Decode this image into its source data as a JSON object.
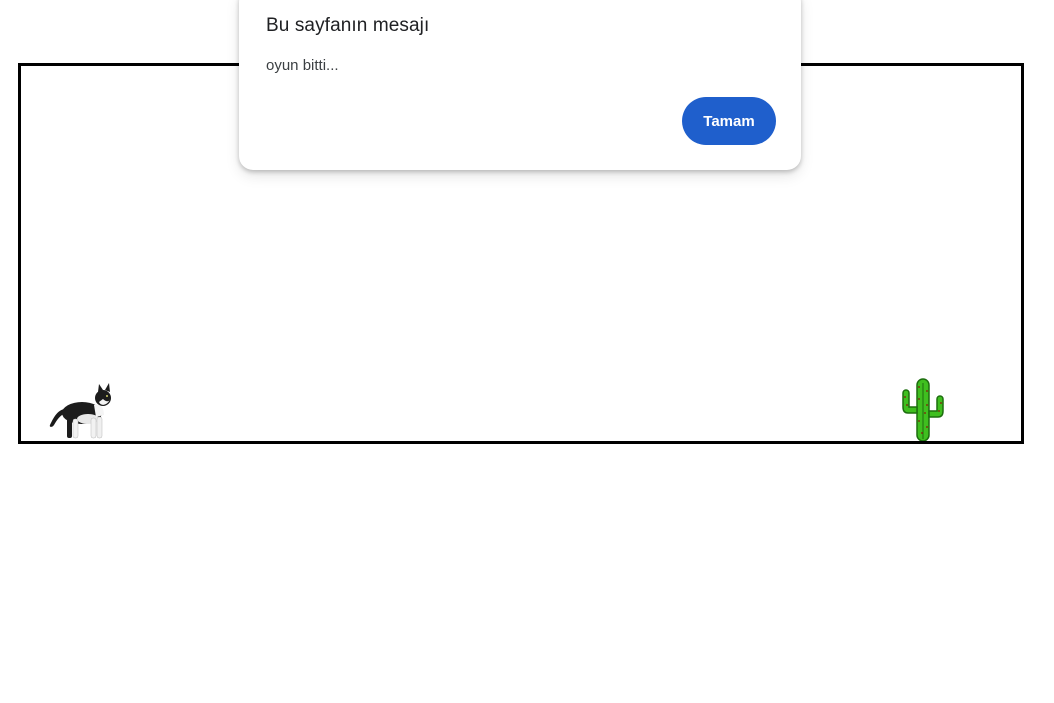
{
  "dialog": {
    "title": "Bu sayfanın mesajı",
    "message": "oyun bitti...",
    "ok_label": "Tamam"
  },
  "game": {
    "player": "cat",
    "obstacle": "cactus",
    "colors": {
      "border": "#000000",
      "button": "#1f5fcc",
      "cactus": "#3fbf1f"
    }
  }
}
